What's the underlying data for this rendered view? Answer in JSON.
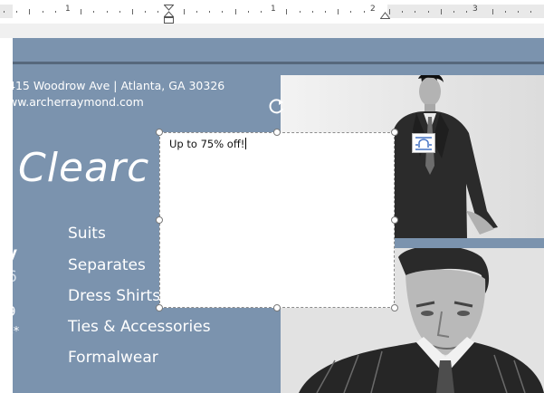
{
  "ruler": {
    "labels": [
      "1",
      "1",
      "2",
      "3"
    ]
  },
  "document": {
    "address_line1": "415 Woodrow Ave | Atlanta, GA 30326",
    "address_line2": "ww.archerraymond.com",
    "headline_fragment": "Clearc",
    "side_fragments": [
      "y",
      "6",
      "9",
      "s*"
    ],
    "menu_items": [
      "Suits",
      "Separates",
      "Dress Shirts",
      "Ties & Accessories",
      "Formalwear"
    ]
  },
  "textbox": {
    "text": "Up to 75% off!"
  },
  "icons": {
    "rotate": "rotate-handle-icon",
    "layout_options": "layout-options-icon"
  },
  "colors": {
    "page_blue": "#7b93ae",
    "page_rule": "#56687c",
    "text_white": "#ffffff"
  }
}
